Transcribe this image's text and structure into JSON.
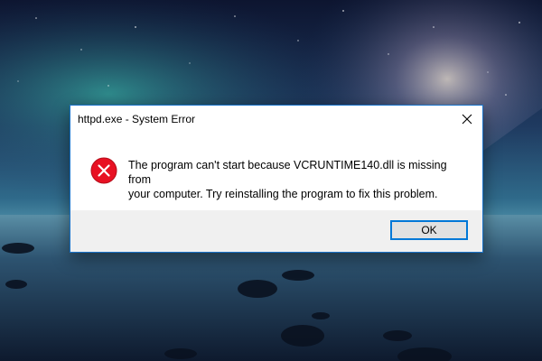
{
  "dialog": {
    "title": "httpd.exe - System Error",
    "close_icon": "close-icon",
    "error_icon": "error-icon",
    "message_line1": "The program can't start because VCRUNTIME140.dll is missing from",
    "message_line2": "your computer. Try reinstalling the program to fix this problem.",
    "ok_label": "OK"
  },
  "colors": {
    "title_border": "#1a73c9",
    "error_red": "#e81123",
    "button_focus": "#0078d7",
    "footer_bg": "#f0f0f0"
  }
}
